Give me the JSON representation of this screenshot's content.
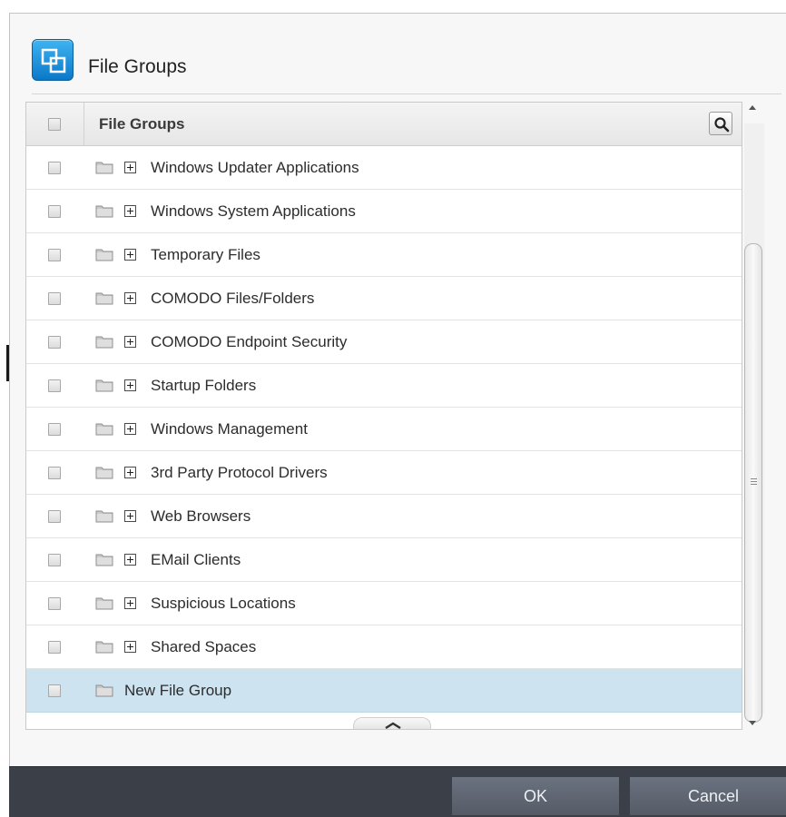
{
  "header": {
    "title": "File Groups",
    "icon": "file-groups-icon"
  },
  "table": {
    "column_header": "File Groups",
    "rows": [
      {
        "label": "Windows Updater Applications",
        "expandable": true,
        "selected": false
      },
      {
        "label": "Windows System Applications",
        "expandable": true,
        "selected": false
      },
      {
        "label": "Temporary Files",
        "expandable": true,
        "selected": false
      },
      {
        "label": "COMODO Files/Folders",
        "expandable": true,
        "selected": false
      },
      {
        "label": "COMODO Endpoint Security",
        "expandable": true,
        "selected": false
      },
      {
        "label": "Startup Folders",
        "expandable": true,
        "selected": false
      },
      {
        "label": "Windows Management",
        "expandable": true,
        "selected": false
      },
      {
        "label": "3rd Party Protocol Drivers",
        "expandable": true,
        "selected": false
      },
      {
        "label": "Web Browsers",
        "expandable": true,
        "selected": false
      },
      {
        "label": "EMail Clients",
        "expandable": true,
        "selected": false
      },
      {
        "label": "Suspicious Locations",
        "expandable": true,
        "selected": false
      },
      {
        "label": "Shared Spaces",
        "expandable": true,
        "selected": false
      },
      {
        "label": "New File Group",
        "expandable": false,
        "selected": true
      }
    ]
  },
  "footer": {
    "ok_label": "OK",
    "cancel_label": "Cancel"
  },
  "colors": {
    "accent": "#0a78c8",
    "selected_row": "#cde3ef",
    "footer_bg": "#3b3f47",
    "button_bg": "#5f6572"
  }
}
